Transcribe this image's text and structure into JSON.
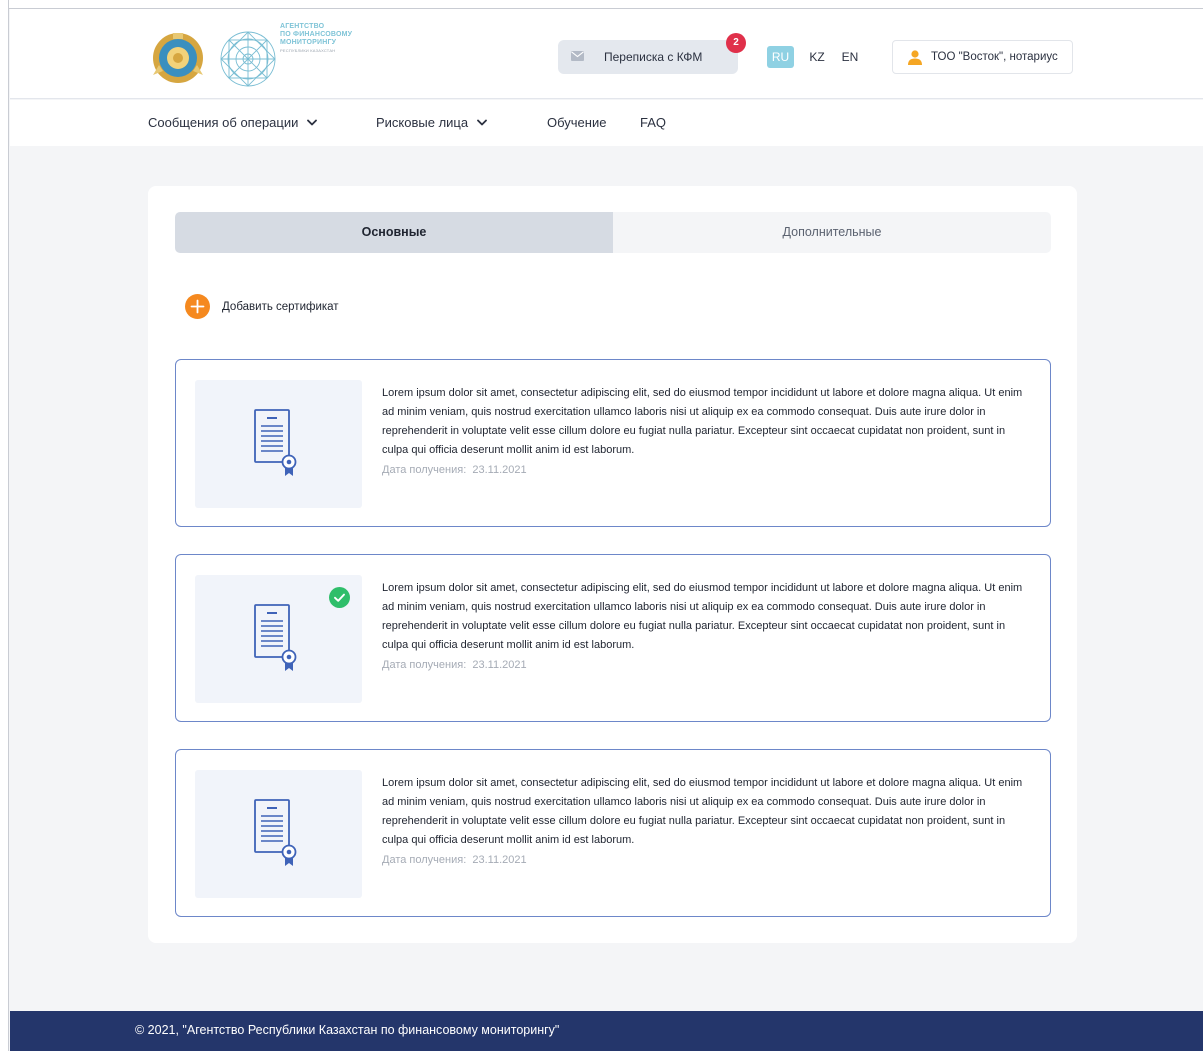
{
  "header": {
    "logo": {
      "line1": "АГЕНТСТВО",
      "line2": "ПО ФИНАНСОВОМУ",
      "line3": "МОНИТОРИНГУ",
      "sub": "РЕСПУБЛИКИ КАЗАХСТАН"
    },
    "messages_label": "Переписка с КФМ",
    "messages_badge": "2",
    "languages": [
      "RU",
      "KZ",
      "EN"
    ],
    "active_language": "RU",
    "user_label": "ТОО \"Восток\", нотариус"
  },
  "nav": {
    "items": [
      {
        "label": "Сообщения об операции",
        "has_dropdown": true
      },
      {
        "label": "Рисковые лица",
        "has_dropdown": true
      },
      {
        "label": "Обучение",
        "has_dropdown": false
      },
      {
        "label": "FAQ",
        "has_dropdown": false
      }
    ]
  },
  "tabs": [
    {
      "label": "Основные",
      "active": true
    },
    {
      "label": "Дополнительные",
      "active": false
    }
  ],
  "add_certificate_label": "Добавить сертификат",
  "certificates": [
    {
      "text": "Lorem ipsum dolor sit amet, consectetur adipiscing elit, sed do eiusmod tempor incididunt ut labore et dolore magna aliqua. Ut enim ad minim veniam, quis nostrud exercitation ullamco laboris nisi ut aliquip ex ea commodo consequat. Duis aute irure dolor in reprehenderit in voluptate velit esse cillum dolore eu fugiat nulla pariatur. Excepteur sint occaecat cupidatat non proident, sunt in culpa qui officia deserunt mollit anim id est laborum.",
      "date_label": "Дата получения:",
      "date": "23.11.2021",
      "verified": false
    },
    {
      "text": "Lorem ipsum dolor sit amet, consectetur adipiscing elit, sed do eiusmod tempor incididunt ut labore et dolore magna aliqua. Ut enim ad minim veniam, quis nostrud exercitation ullamco laboris nisi ut aliquip ex ea commodo consequat. Duis aute irure dolor in reprehenderit in voluptate velit esse cillum dolore eu fugiat nulla pariatur. Excepteur sint occaecat cupidatat non proident, sunt in culpa qui officia deserunt mollit anim id est laborum.",
      "date_label": "Дата получения:",
      "date": "23.11.2021",
      "verified": true
    },
    {
      "text": "Lorem ipsum dolor sit amet, consectetur adipiscing elit, sed do eiusmod tempor incididunt ut labore et dolore magna aliqua. Ut enim ad minim veniam, quis nostrud exercitation ullamco laboris nisi ut aliquip ex ea commodo consequat. Duis aute irure dolor in reprehenderit in voluptate velit esse cillum dolore eu fugiat nulla pariatur. Excepteur sint occaecat cupidatat non proident, sunt in culpa qui officia deserunt mollit anim id est laborum.",
      "date_label": "Дата получения:",
      "date": "23.11.2021",
      "verified": false
    }
  ],
  "footer": {
    "copyright": "© 2021, \"Агентство Республики Казахстан по финансовому мониторингу\""
  },
  "colors": {
    "accent_orange": "#f5891f",
    "success_green": "#2fbe6a",
    "badge_red": "#e0304a",
    "lang_active": "#8fd1e3",
    "card_border": "#6d87c9",
    "footer_bg": "#24366b",
    "icon_blue": "#3f63b8"
  },
  "icons": {
    "messages": "mail-icon",
    "user": "user-icon",
    "add": "plus-circle-icon",
    "certificate": "certificate-document-icon",
    "verified": "check-circle-icon",
    "dropdown": "chevron-down-icon"
  }
}
